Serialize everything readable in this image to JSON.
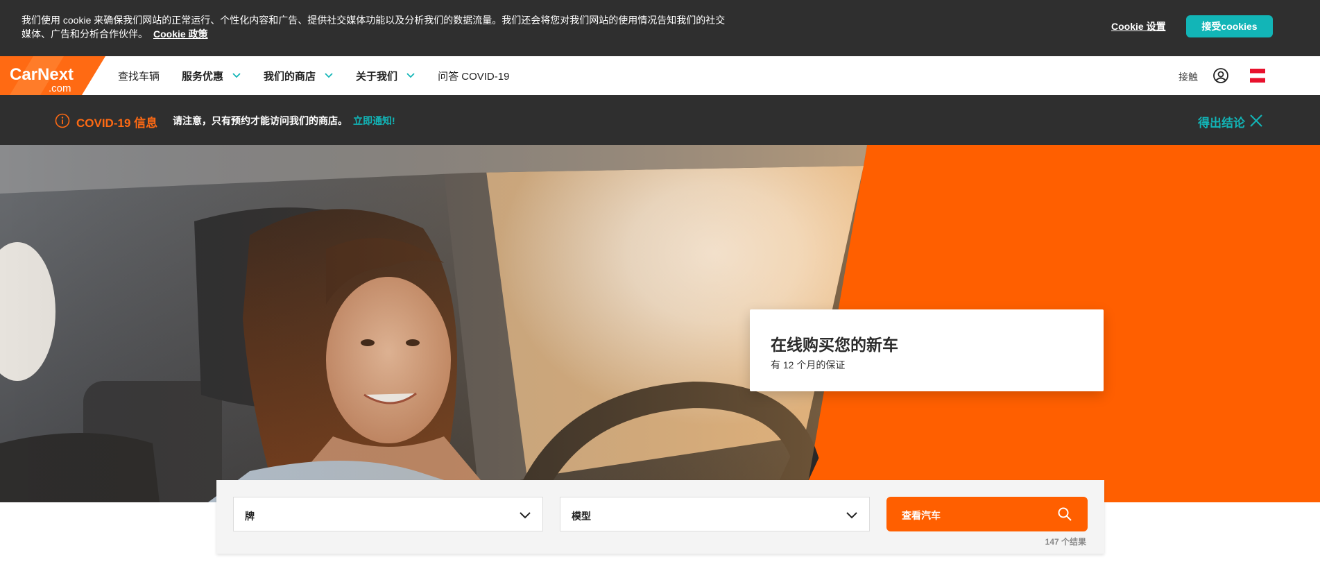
{
  "cookie": {
    "text": "我们使用 cookie 来确保我们网站的正常运行、个性化内容和广告、提供社交媒体功能以及分析我们的数据流量。我们还会将您对我们网站的使用情况告知我们的社交媒体、广告和分析合作伙伴。",
    "policy_link": "Cookie 政策",
    "settings_label": "Cookie 设置",
    "accept_label": "接受cookies"
  },
  "header": {
    "logo_text": "CarNext",
    "logo_sub": ".com",
    "nav": [
      {
        "label": "查找车辆"
      },
      {
        "label": "服务优惠"
      },
      {
        "label": "我们的商店"
      },
      {
        "label": "关于我们"
      },
      {
        "label": "问答 COVID-19"
      }
    ],
    "contact_label": "接触",
    "colors": {
      "brand_orange": "#ff6a13",
      "teal": "#12b5b7"
    }
  },
  "covid": {
    "title": "COVID-19 信息",
    "message": "请注意，只有预约才能访问我们的商店。",
    "link": "立即通知!",
    "close_label": "得出结论"
  },
  "hero": {
    "title": "在线购买您的新车",
    "subtitle": "有 12 个月的保证"
  },
  "search": {
    "brand_label": "牌",
    "model_label": "模型",
    "button_label": "查看汽车",
    "results": "147 个结果"
  }
}
